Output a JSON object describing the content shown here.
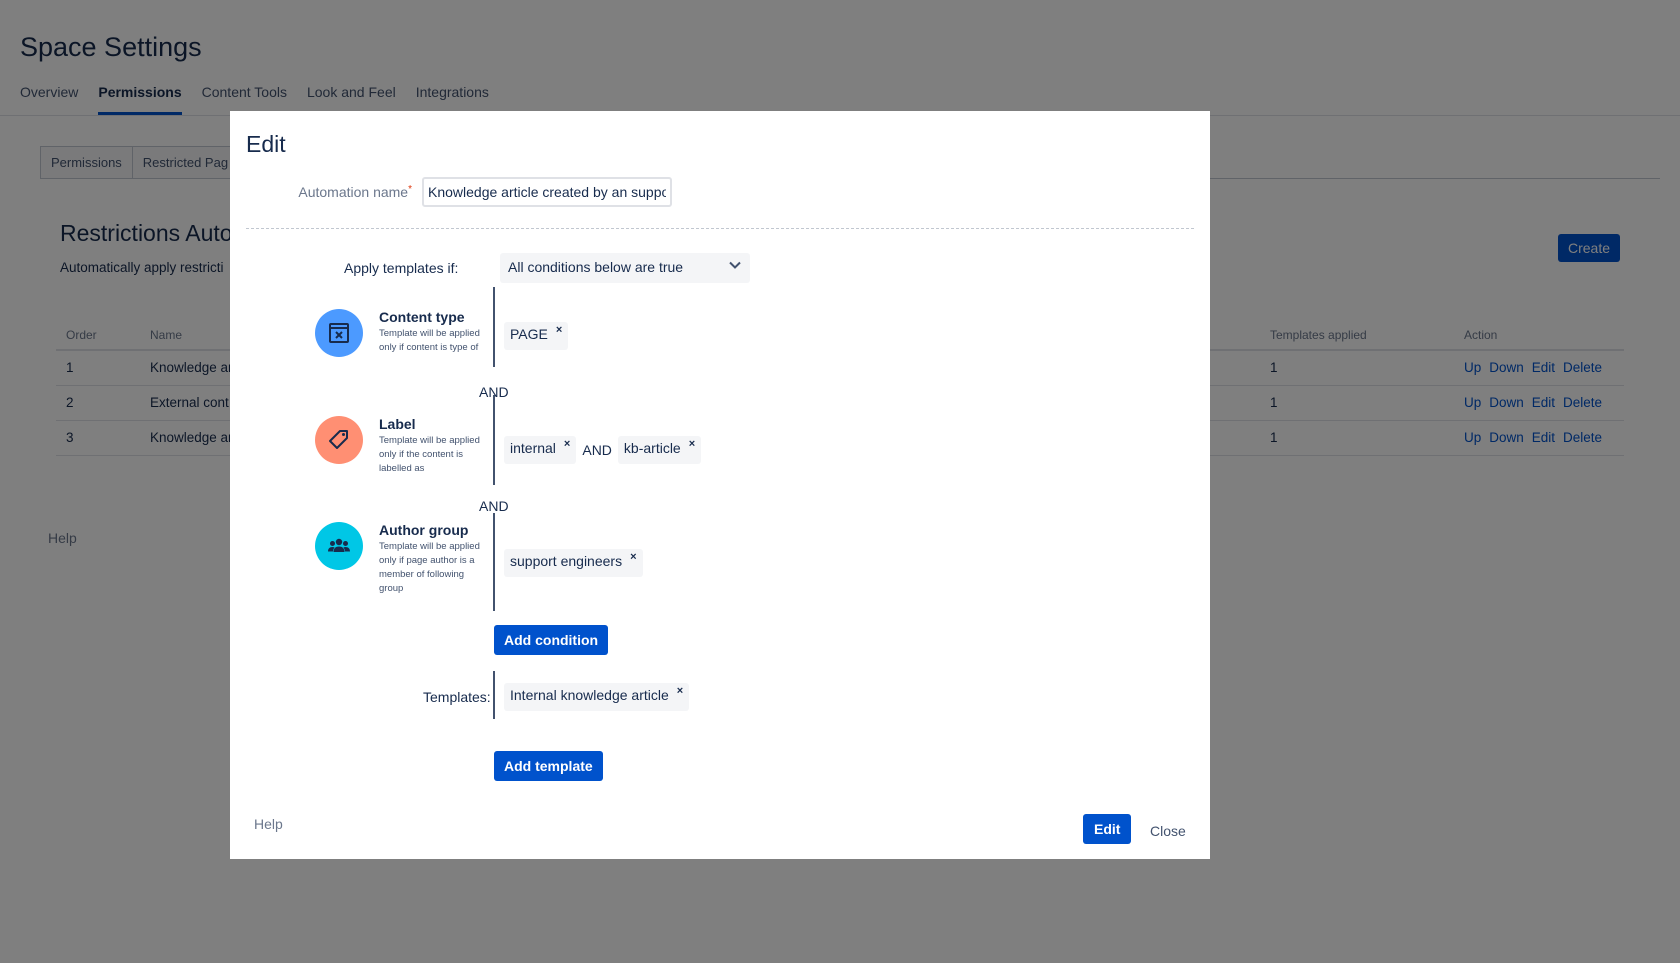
{
  "background": {
    "page_title": "Space Settings",
    "top_tabs": [
      {
        "label": "Overview"
      },
      {
        "label": "Permissions"
      },
      {
        "label": "Content Tools"
      },
      {
        "label": "Look and Feel"
      },
      {
        "label": "Integrations"
      }
    ],
    "sub_tabs": [
      {
        "label": "Permissions"
      },
      {
        "label": "Restricted Pag"
      }
    ],
    "section_title": "Restrictions Auto",
    "section_desc": "Automatically apply restricti",
    "create_label": "Create",
    "table": {
      "headers": [
        "Order",
        "Name",
        "Templates applied",
        "Action"
      ],
      "rows": [
        {
          "order": "1",
          "name": "Knowledge ar",
          "templates": "1"
        },
        {
          "order": "2",
          "name": "External cont",
          "templates": "1"
        },
        {
          "order": "3",
          "name": "Knowledge ar",
          "templates": "1"
        }
      ],
      "actions": {
        "up": "Up",
        "down": "Down",
        "edit": "Edit",
        "delete": "Delete"
      }
    },
    "help": "Help"
  },
  "modal": {
    "title": "Edit",
    "name_label": "Automation name",
    "required_mark": "*",
    "name_value": "Knowledge article created by an support engineer",
    "apply_label": "Apply templates if:",
    "apply_value": "All conditions below are true",
    "conditions": {
      "content_type": {
        "title": "Content type",
        "desc": "Template will be applied only if content is type of",
        "chips": [
          "PAGE"
        ],
        "icon": "content-type-icon",
        "color": "#4c9aff"
      },
      "label": {
        "title": "Label",
        "desc": "Template will be applied only if the content is labelled as",
        "chips": [
          "internal",
          "kb-article"
        ],
        "icon": "tag-icon",
        "color": "#ff8f73"
      },
      "author_group": {
        "title": "Author group",
        "desc": "Template will be applied only if page author is a member of following group",
        "chips": [
          "support engineers"
        ],
        "icon": "people-group-icon",
        "color": "#00c7e6"
      }
    },
    "and_text": "AND",
    "chip_remove": "×",
    "add_condition": "Add condition",
    "templates_label": "Templates:",
    "templates": [
      "Internal knowledge article"
    ],
    "add_template": "Add template",
    "help": "Help",
    "edit_button": "Edit",
    "close_button": "Close"
  }
}
